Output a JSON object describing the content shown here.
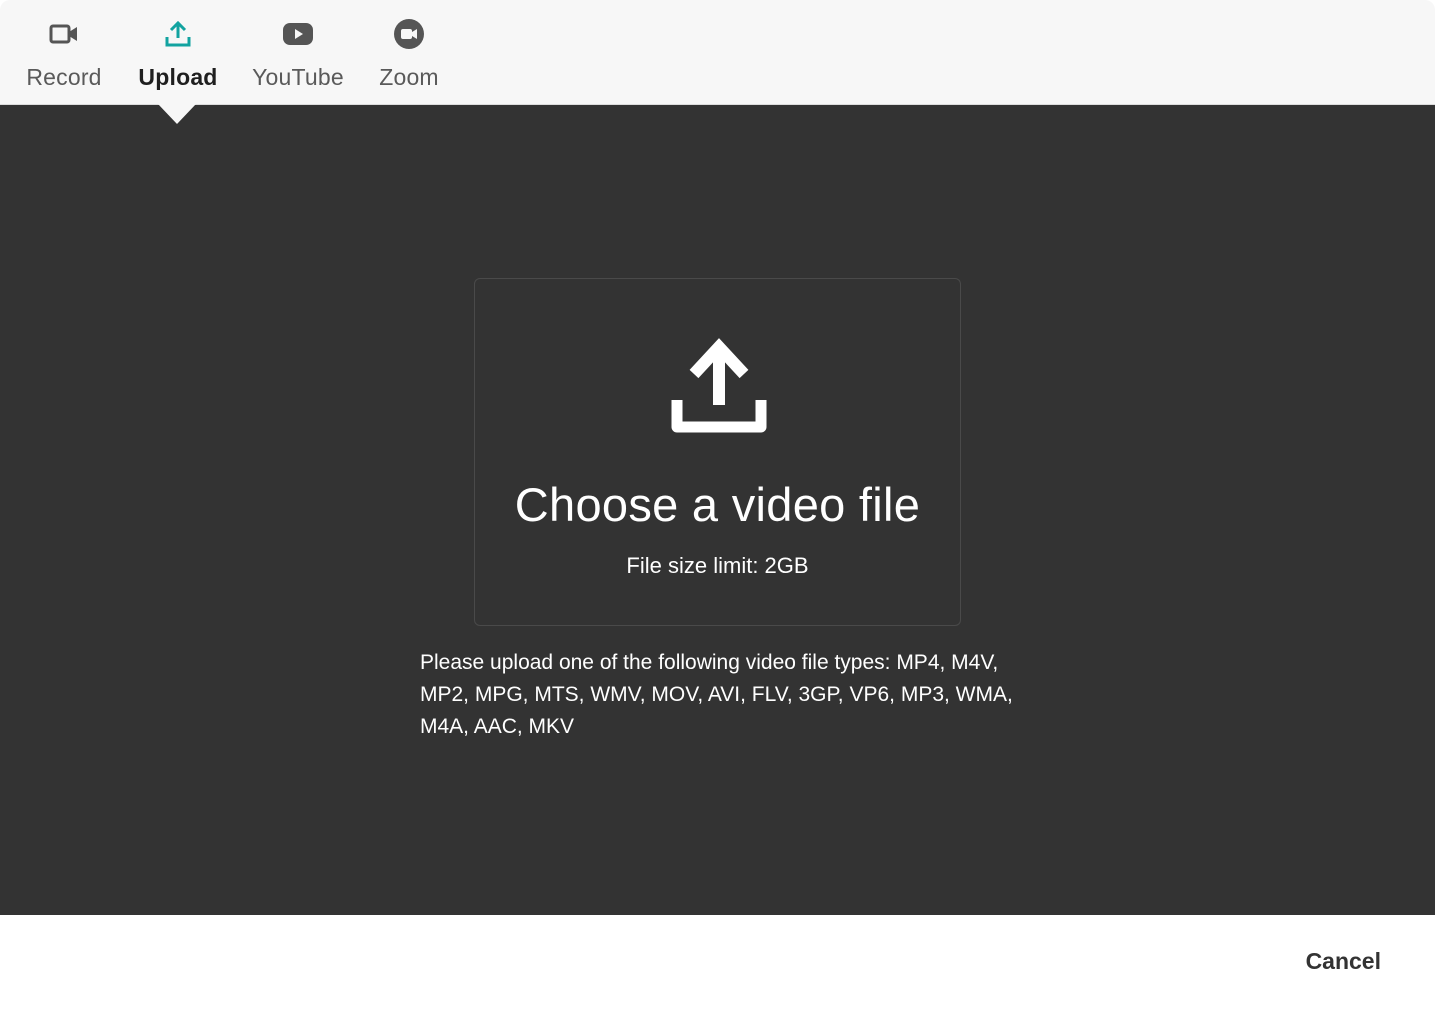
{
  "tabs": [
    {
      "id": "record",
      "label": "Record",
      "icon": "video-camera-icon",
      "active": false
    },
    {
      "id": "upload",
      "label": "Upload",
      "icon": "upload-icon",
      "active": true
    },
    {
      "id": "youtube",
      "label": "YouTube",
      "icon": "youtube-icon",
      "active": false
    },
    {
      "id": "zoom",
      "label": "Zoom",
      "icon": "zoom-icon",
      "active": false
    }
  ],
  "dropzone": {
    "icon": "upload-icon",
    "title": "Choose a video file",
    "size_limit": "File size limit: 2GB"
  },
  "file_types_text": "Please upload one of the following video file types: MP4, M4V, MP2, MPG, MTS, WMV, MOV, AVI, FLV, 3GP, VP6, MP3, WMA, M4A, AAC, MKV",
  "footer": {
    "cancel_label": "Cancel"
  },
  "colors": {
    "accent": "#12a3a0",
    "icon_gray": "#555555",
    "main_bg": "#333333",
    "tabbar_bg": "#f7f7f7"
  }
}
